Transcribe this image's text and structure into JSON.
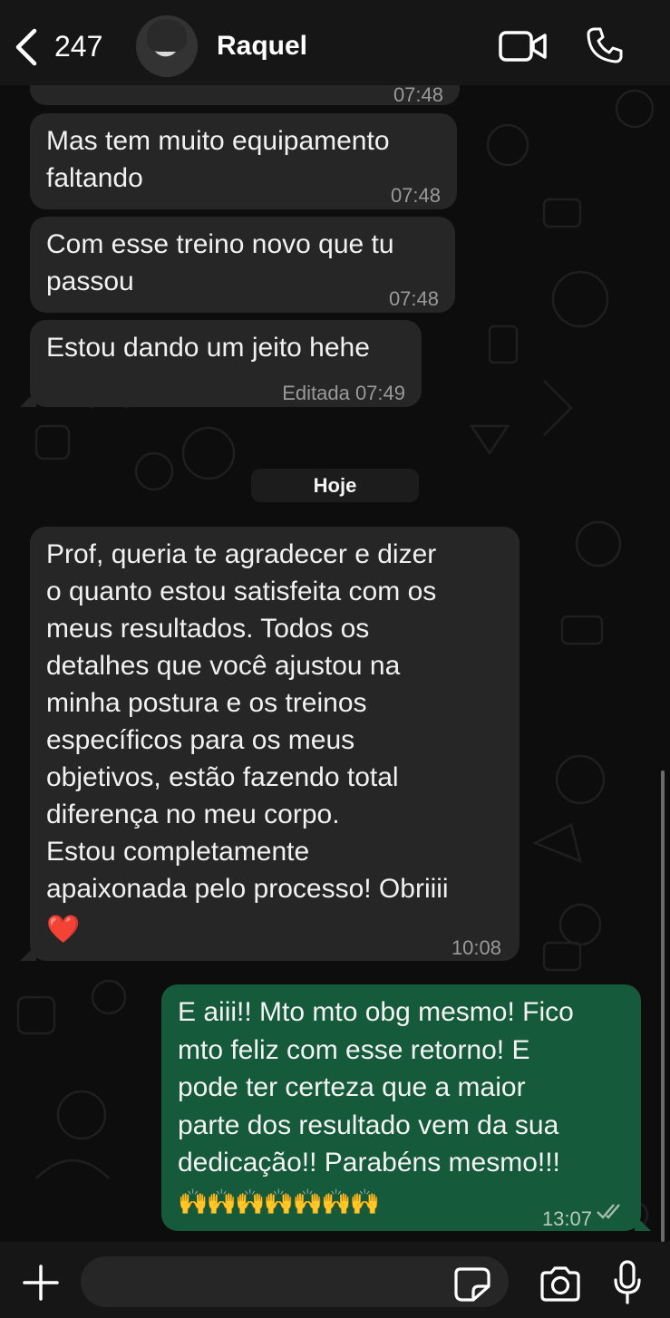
{
  "header": {
    "back_count": "247",
    "contact_name": "Raquel"
  },
  "messages": [
    {
      "text": "Mas tem muito equipamento\nfaltando",
      "time": "07:48"
    },
    {
      "text": "Com esse treino novo que tu\npassou",
      "time": "07:48"
    },
    {
      "text": "Estou dando um jeito hehe",
      "time": "Editada 07:49"
    }
  ],
  "partial_time": "07:48",
  "date_divider": "Hoje",
  "incoming_long": {
    "text": "Prof, queria te agradecer e dizer\no quanto estou satisfeita com os\nmeus resultados. Todos os\ndetalhes que você ajustou na\nminha postura e os treinos\nespecíficos para os meus\nobjetivos, estão fazendo total\ndiferença no meu corpo.\nEstou completamente\napaixonada pelo processo! Obriiii",
    "emoji": "❤️",
    "time": "10:08"
  },
  "outgoing": {
    "text": "E aiii!! Mto mto obg mesmo! Fico\nmto feliz com esse retorno! E\npode ter certeza que a maior\nparte dos resultado vem da sua\ndedicação!! Parabéns mesmo!!!",
    "emoji": "🙌🙌🙌🙌🙌🙌🙌",
    "time": "13:07",
    "status_icon": "double-check-icon"
  },
  "composer": {
    "placeholder": ""
  },
  "colors": {
    "incoming_bubble": "#262626",
    "outgoing_bubble": "#155a3a",
    "background": "#0d0d0d"
  }
}
